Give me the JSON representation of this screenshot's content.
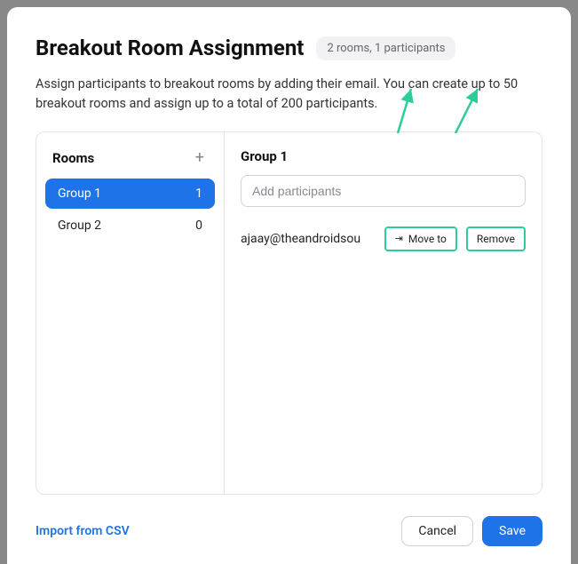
{
  "header": {
    "title": "Breakout Room Assignment",
    "badge": "2 rooms, 1 participants"
  },
  "description": "Assign participants to breakout rooms by adding their email. You can create up to 50 breakout rooms and assign up to a total of 200 participants.",
  "rooms_panel": {
    "heading": "Rooms",
    "add_icon": "+"
  },
  "rooms": [
    {
      "name": "Group 1",
      "count": "1",
      "selected": true
    },
    {
      "name": "Group 2",
      "count": "0",
      "selected": false
    }
  ],
  "detail": {
    "title": "Group 1",
    "input_placeholder": "Add participants",
    "participants": [
      {
        "email": "ajaay@theandroidsou"
      }
    ],
    "move_to_label": "Move to",
    "remove_label": "Remove"
  },
  "footer": {
    "import_label": "Import from CSV",
    "cancel_label": "Cancel",
    "save_label": "Save"
  },
  "annotation": {
    "stroke": "#2ecc9b"
  }
}
